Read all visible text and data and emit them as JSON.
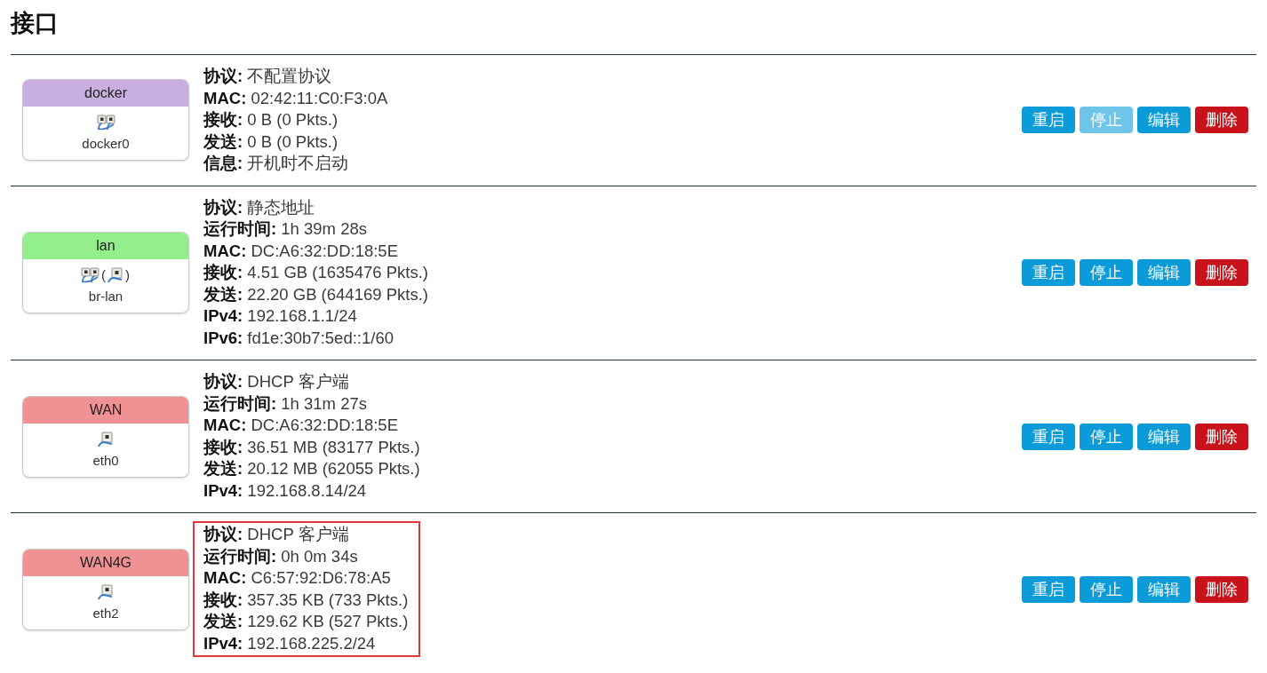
{
  "title": "接口",
  "interfaces": [
    {
      "name": "docker",
      "color": "#c9aee0",
      "icons": [
        {
          "kind": "bridge"
        }
      ],
      "device": "docker0",
      "highlighted": false,
      "details": [
        "**协议:** 不配置协议",
        "**MAC:** 02:42:11:C0:F3:0A",
        "**接收:** 0 B (0 Pkts.)",
        "**发送:** 0 B (0 Pkts.)",
        "**信息:** 开机时不启动"
      ],
      "buttons": [
        {
          "label": "重启",
          "kind": "primary",
          "disabled": false
        },
        {
          "label": "停止",
          "kind": "primary",
          "disabled": true
        },
        {
          "label": "编辑",
          "kind": "primary",
          "disabled": false
        },
        {
          "label": "删除",
          "kind": "danger",
          "disabled": false
        }
      ]
    },
    {
      "name": "lan",
      "color": "#93ee8c",
      "icons": [
        {
          "kind": "bridge"
        },
        {
          "kind": "text",
          "text": "("
        },
        {
          "kind": "ethernet"
        },
        {
          "kind": "text",
          "text": ")"
        }
      ],
      "device": "br-lan",
      "highlighted": false,
      "details": [
        "**协议:** 静态地址",
        "**运行时间:** 1h 39m 28s",
        "**MAC:** DC:A6:32:DD:18:5E",
        "**接收:** 4.51 GB (1635476 Pkts.)",
        "**发送:** 22.20 GB (644169 Pkts.)",
        "**IPv4:** 192.168.1.1/24",
        "**IPv6:** fd1e:30b7:5ed::1/60"
      ],
      "buttons": [
        {
          "label": "重启",
          "kind": "primary",
          "disabled": false
        },
        {
          "label": "停止",
          "kind": "primary",
          "disabled": false
        },
        {
          "label": "编辑",
          "kind": "primary",
          "disabled": false
        },
        {
          "label": "删除",
          "kind": "danger",
          "disabled": false
        }
      ]
    },
    {
      "name": "WAN",
      "color": "#f09193",
      "icons": [
        {
          "kind": "ethernet"
        }
      ],
      "device": "eth0",
      "highlighted": false,
      "details": [
        "**协议:** DHCP 客户端",
        "**运行时间:** 1h 31m 27s",
        "**MAC:** DC:A6:32:DD:18:5E",
        "**接收:** 36.51 MB (83177 Pkts.)",
        "**发送:** 20.12 MB (62055 Pkts.)",
        "**IPv4:** 192.168.8.14/24"
      ],
      "buttons": [
        {
          "label": "重启",
          "kind": "primary",
          "disabled": false
        },
        {
          "label": "停止",
          "kind": "primary",
          "disabled": false
        },
        {
          "label": "编辑",
          "kind": "primary",
          "disabled": false
        },
        {
          "label": "删除",
          "kind": "danger",
          "disabled": false
        }
      ]
    },
    {
      "name": "WAN4G",
      "color": "#f09193",
      "icons": [
        {
          "kind": "ethernet"
        }
      ],
      "device": "eth2",
      "highlighted": true,
      "details": [
        "**协议:** DHCP 客户端",
        "**运行时间:** 0h 0m 34s",
        "**MAC:** C6:57:92:D6:78:A5",
        "**接收:** 357.35 KB (733 Pkts.)",
        "**发送:** 129.62 KB (527 Pkts.)",
        "**IPv4:** 192.168.225.2/24"
      ],
      "buttons": [
        {
          "label": "重启",
          "kind": "primary",
          "disabled": false
        },
        {
          "label": "停止",
          "kind": "primary",
          "disabled": false
        },
        {
          "label": "编辑",
          "kind": "primary",
          "disabled": false
        },
        {
          "label": "删除",
          "kind": "danger",
          "disabled": false
        }
      ]
    }
  ]
}
